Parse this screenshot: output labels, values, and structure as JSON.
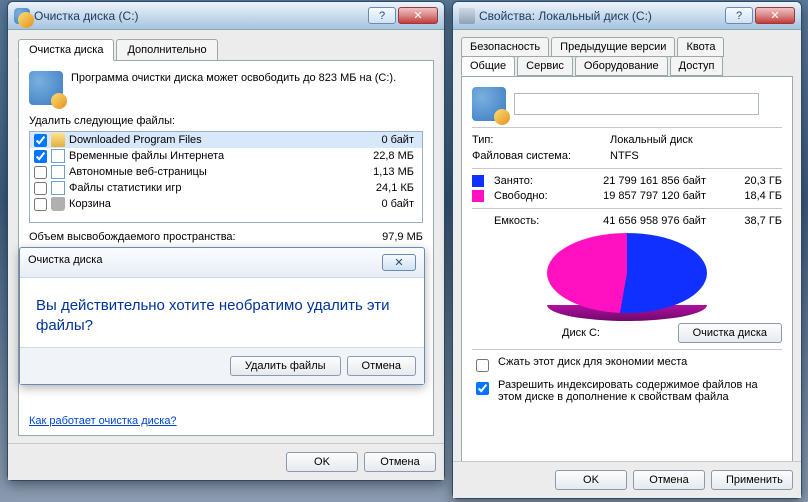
{
  "cleanup": {
    "title": "Очистка диска  (C:)",
    "tabs": {
      "main": "Очистка диска",
      "extra": "Дополнительно"
    },
    "intro": "Программа очистки диска может освободить до 823 МБ на  (C:).",
    "deleteLabel": "Удалить следующие файлы:",
    "files": [
      {
        "name": "Downloaded Program Files",
        "size": "0 байт",
        "icon": "folder",
        "checked": true,
        "selected": true
      },
      {
        "name": "Временные файлы Интернета",
        "size": "22,8 МБ",
        "icon": "page",
        "checked": true,
        "selected": false
      },
      {
        "name": "Автономные веб-страницы",
        "size": "1,13 МБ",
        "icon": "page",
        "checked": false,
        "selected": false
      },
      {
        "name": "Файлы статистики игр",
        "size": "24,1 КБ",
        "icon": "page",
        "checked": false,
        "selected": false
      },
      {
        "name": "Корзина",
        "size": "0 байт",
        "icon": "bin",
        "checked": false,
        "selected": false
      }
    ],
    "totalLabel": "Объем высвобождаемого пространства:",
    "totalVal": "97,9 МБ",
    "linkHow": "Как работает очистка диска?",
    "ok": "OK",
    "cancel": "Отмена"
  },
  "confirm": {
    "title": "Очистка диска",
    "question": "Вы действительно хотите необратимо удалить эти файлы?",
    "delete": "Удалить файлы",
    "cancel": "Отмена"
  },
  "props": {
    "title": "Свойства: Локальный диск (C:)",
    "tabsTop": {
      "sec": "Безопасность",
      "prev": "Предыдущие версии",
      "quota": "Квота"
    },
    "tabsBottom": {
      "gen": "Общие",
      "svc": "Сервис",
      "hw": "Оборудование",
      "acc": "Доступ"
    },
    "typeLabel": "Тип:",
    "typeVal": "Локальный диск",
    "fsLabel": "Файловая система:",
    "fsVal": "NTFS",
    "usedLabel": "Занято:",
    "usedBytes": "21 799 161 856 байт",
    "usedGb": "20,3 ГБ",
    "freeLabel": "Свободно:",
    "freeBytes": "19 857 797 120 байт",
    "freeGb": "18,4 ГБ",
    "capLabel": "Емкость:",
    "capBytes": "41 656 958 976 байт",
    "capGb": "38,7 ГБ",
    "driveLabel": "Диск C:",
    "cleanupBtn": "Очистка диска",
    "compress": "Сжать этот диск для экономии места",
    "index": "Разрешить индексировать содержимое файлов на этом диске в дополнение к свойствам файла",
    "ok": "OK",
    "cancel": "Отмена",
    "apply": "Применить"
  }
}
